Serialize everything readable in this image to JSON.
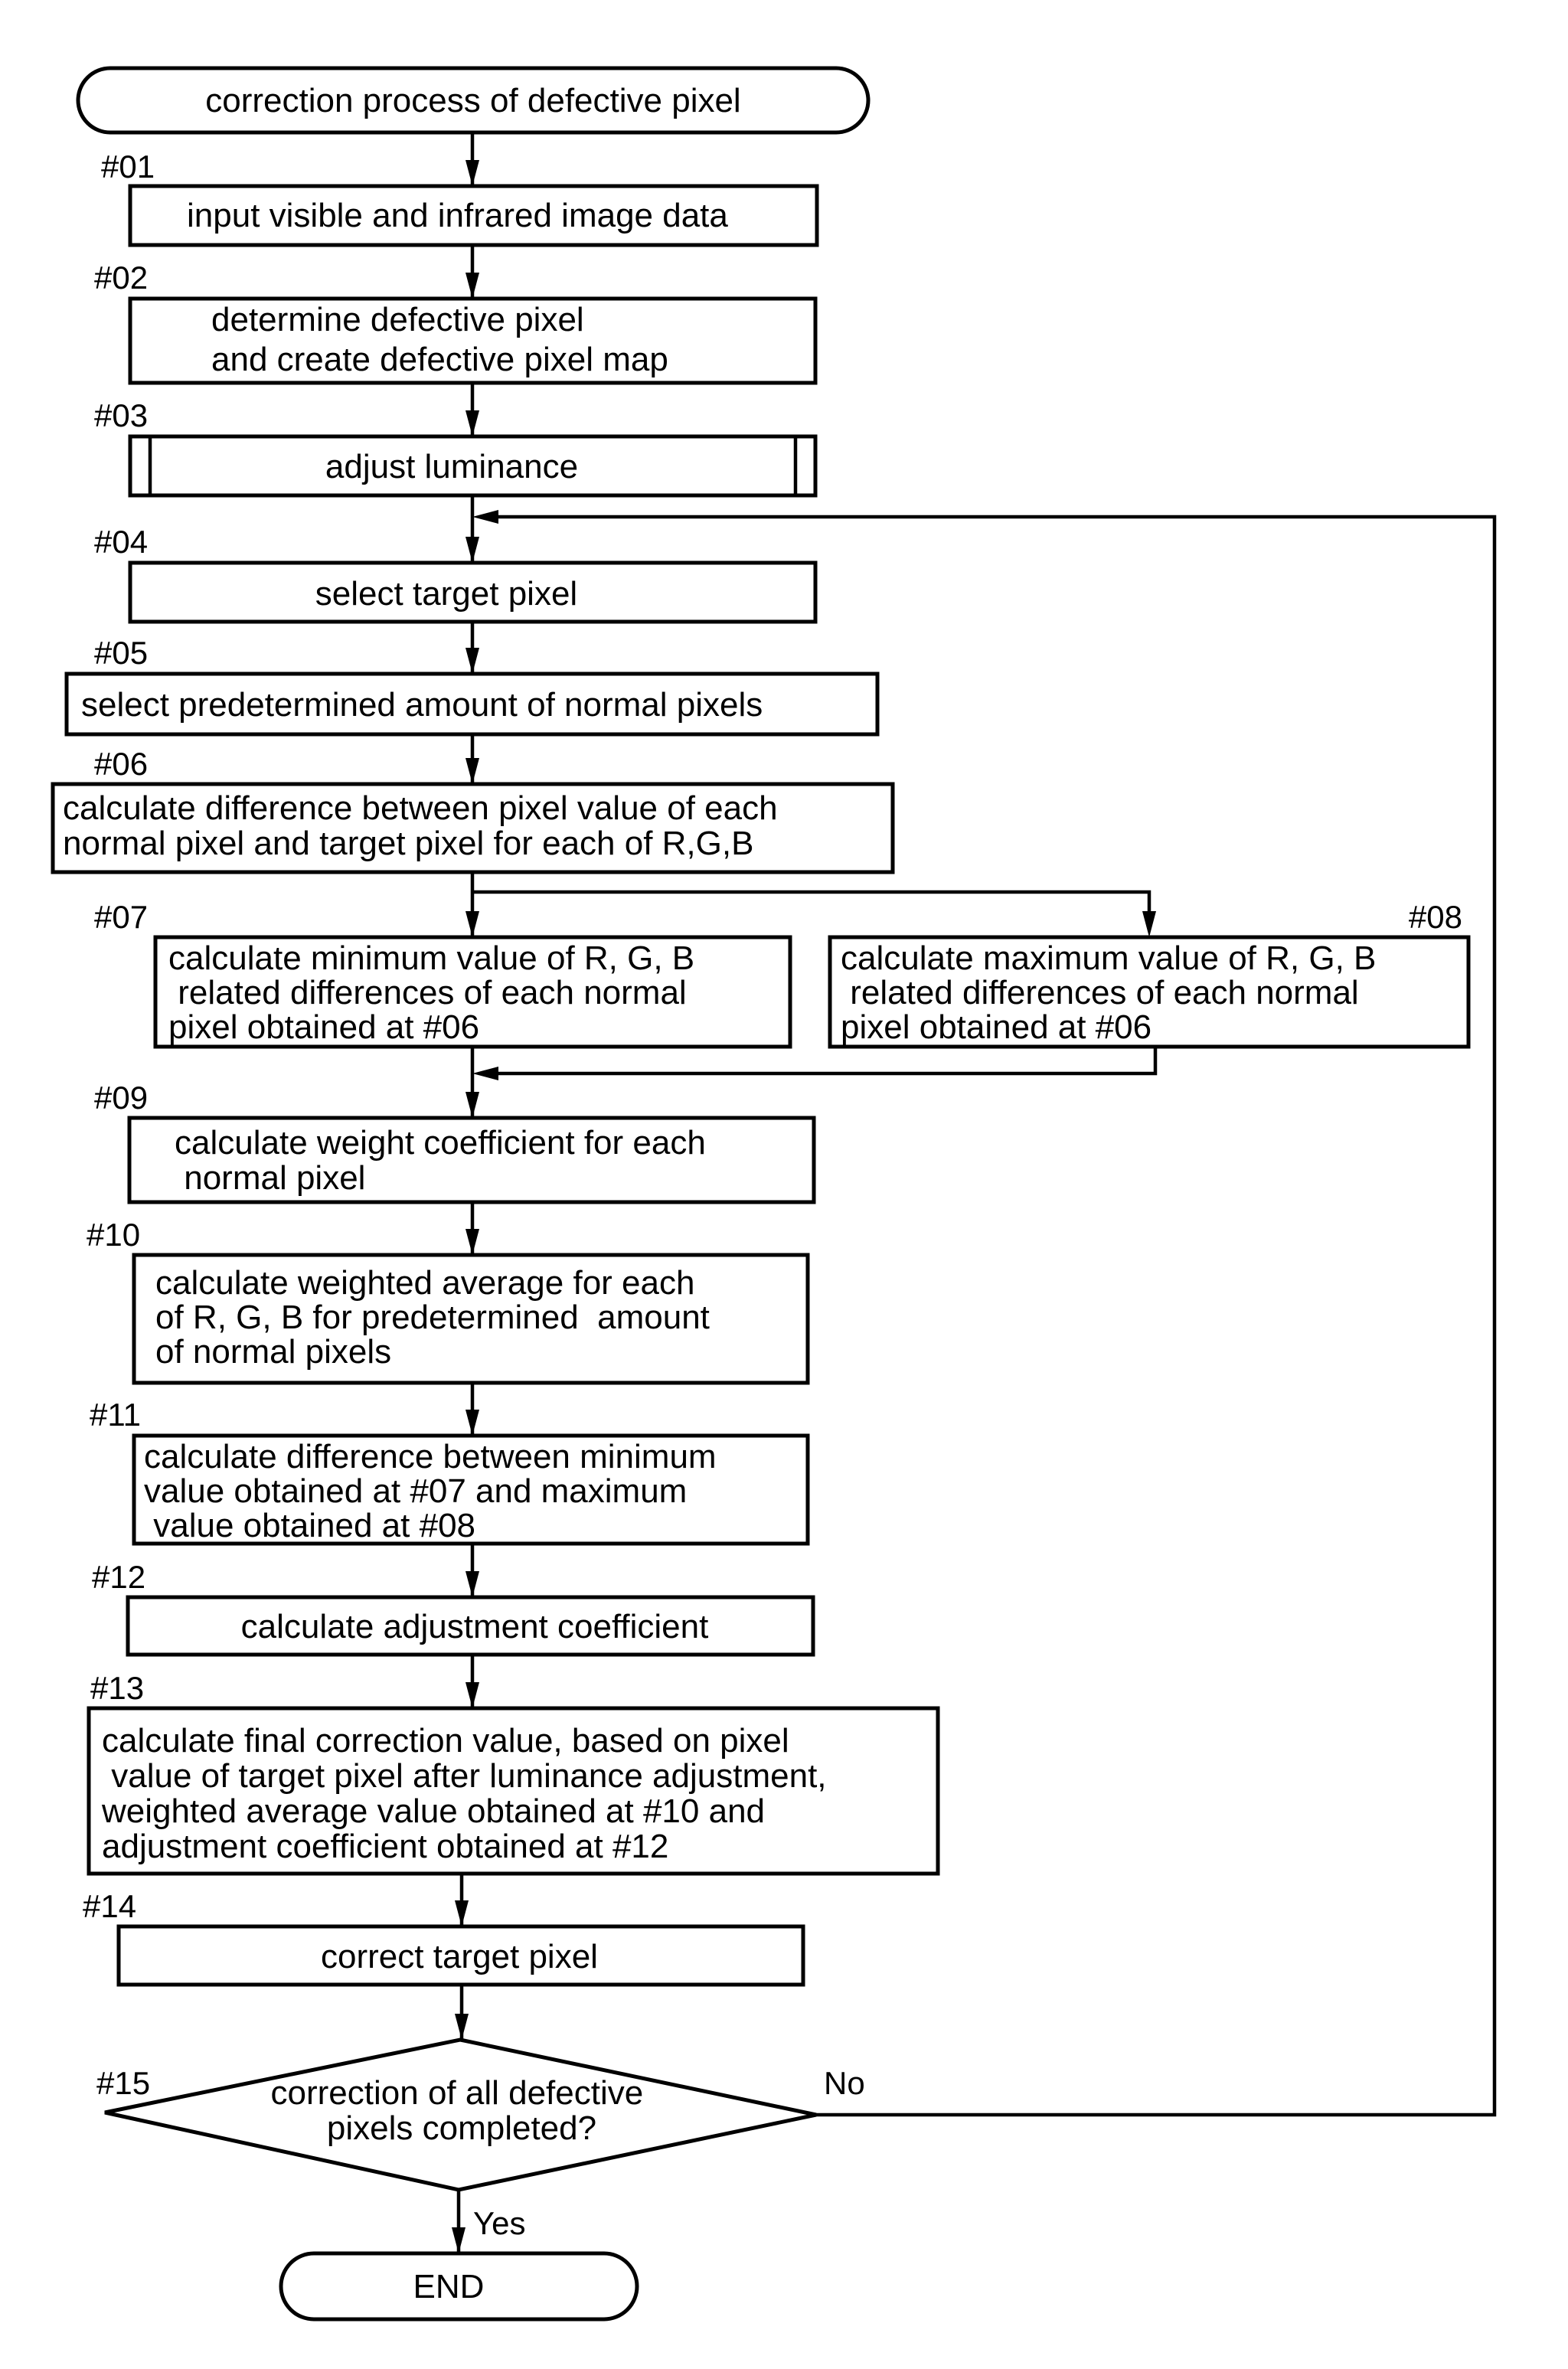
{
  "diagram": {
    "type": "flowchart",
    "start": {
      "label": "correction process of defective pixel"
    },
    "end": {
      "label": "END"
    },
    "steps": [
      {
        "id": "#01",
        "lines": [
          "input visible and infrared image data"
        ]
      },
      {
        "id": "#02",
        "lines": [
          "determine defective pixel",
          "and create defective pixel map"
        ]
      },
      {
        "id": "#03",
        "lines": [
          "adjust luminance"
        ],
        "kind": "subroutine"
      },
      {
        "id": "#04",
        "lines": [
          "select target pixel"
        ]
      },
      {
        "id": "#05",
        "lines": [
          "select predetermined amount of normal pixels"
        ]
      },
      {
        "id": "#06",
        "lines": [
          "calculate difference between pixel value of each",
          "normal pixel and target pixel for each of R,G,B"
        ]
      },
      {
        "id": "#07",
        "lines": [
          "calculate minimum value of R, G, B",
          " related differences of each normal",
          "pixel obtained at #06"
        ]
      },
      {
        "id": "#08",
        "lines": [
          "calculate maximum value of R, G, B",
          " related differences of each normal",
          "pixel obtained at #06"
        ]
      },
      {
        "id": "#09",
        "lines": [
          "calculate weight coefficient for each",
          " normal pixel"
        ]
      },
      {
        "id": "#10",
        "lines": [
          "calculate weighted average for each",
          "of R, G, B for predetermined  amount",
          "of normal pixels"
        ]
      },
      {
        "id": "#11",
        "lines": [
          "calculate difference between minimum",
          "value obtained at #07 and maximum",
          " value obtained at #08"
        ]
      },
      {
        "id": "#12",
        "lines": [
          "calculate adjustment coefficient"
        ]
      },
      {
        "id": "#13",
        "lines": [
          "calculate final correction value, based on pixel",
          " value of target pixel after luminance adjustment,",
          "weighted average value obtained at #10 and",
          "adjustment coefficient obtained at #12"
        ]
      },
      {
        "id": "#14",
        "lines": [
          "correct target pixel"
        ]
      }
    ],
    "decision": {
      "id": "#15",
      "lines": [
        "correction of all defective",
        "pixels completed?"
      ],
      "yes_label": "Yes",
      "no_label": "No"
    }
  }
}
